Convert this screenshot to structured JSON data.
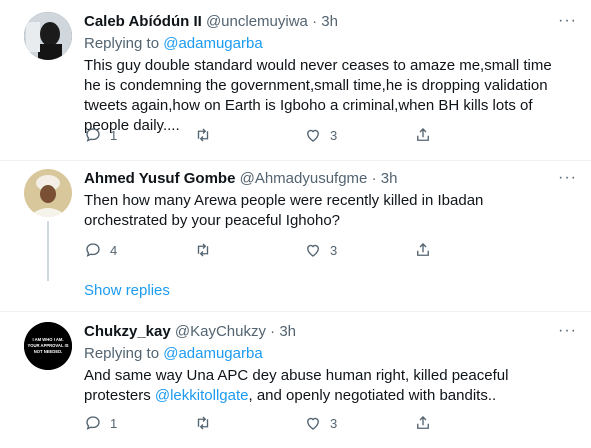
{
  "tweets": [
    {
      "name": "Caleb Abíódún II",
      "handle": "@unclemuyiwa",
      "separator": "·",
      "time": "3h",
      "replying_prefix": "Replying to",
      "replying_to": "@adamugarba",
      "text": "This guy double standard would never ceases to amaze me,small time he is condemning the government,small time,he is dropping validation tweets again,how on Earth is Igboho a criminal,when BH kills lots of people daily....",
      "replies": "1",
      "retweets": "",
      "likes": "3"
    },
    {
      "name": "Ahmed Yusuf Gombe",
      "handle": "@Ahmadyusufgme",
      "separator": "·",
      "time": "3h",
      "text": "Then how many Arewa people were recently killed in Ibadan orchestrated by your peaceful Ighoho?",
      "replies": "4",
      "retweets": "",
      "likes": "3"
    },
    {
      "name": "Chukzy_kay",
      "handle": "@KayChukzy",
      "separator": "·",
      "time": "3h",
      "replying_prefix": "Replying to",
      "replying_to": "@adamugarba",
      "text_before": "And same way Una APC dey abuse human right, killed peaceful protesters",
      "inline_mention": "@lekkitollgate",
      "text_after": ", and openly negotiated with bandits..",
      "avatar_text": "I AM WHO I AM. YOUR APPROVAL IS NOT NEEDED.",
      "replies": "1",
      "retweets": "",
      "likes": "3"
    }
  ],
  "show_replies": "Show replies",
  "more_glyph": "···",
  "colors": {
    "accent": "#1d9bf0",
    "muted": "#536471",
    "text": "#0f1419"
  },
  "icons": [
    "reply-icon",
    "retweet-icon",
    "like-icon",
    "share-icon",
    "more-icon"
  ]
}
